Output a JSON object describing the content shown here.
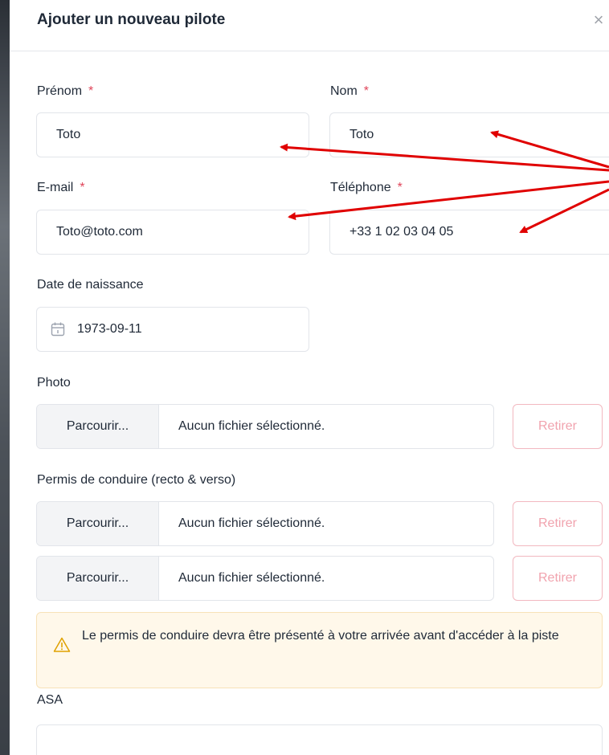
{
  "modal": {
    "title": "Ajouter un nouveau pilote",
    "close_icon": "×"
  },
  "form": {
    "required_mark": "*",
    "first_name": {
      "label": "Prénom",
      "value": "Toto"
    },
    "last_name": {
      "label": "Nom",
      "value": "Toto"
    },
    "email": {
      "label": "E-mail",
      "value": "Toto@toto.com"
    },
    "phone": {
      "label": "Téléphone",
      "value": "+33 1 02 03 04 05"
    },
    "birth_date": {
      "label": "Date de naissance",
      "value": "1973-09-11",
      "icon": "calendar-icon"
    },
    "photo": {
      "label": "Photo",
      "browse_label": "Parcourir...",
      "file_text": "Aucun fichier sélectionné.",
      "remove_label": "Retirer"
    },
    "license": {
      "label": "Permis de conduire (recto & verso)",
      "files": [
        {
          "browse_label": "Parcourir...",
          "file_text": "Aucun fichier sélectionné.",
          "remove_label": "Retirer"
        },
        {
          "browse_label": "Parcourir...",
          "file_text": "Aucun fichier sélectionné.",
          "remove_label": "Retirer"
        }
      ]
    },
    "license_notice": {
      "icon": "warning-icon",
      "text": "Le permis de conduire devra être présenté à votre arrivée avant d'accéder à la piste"
    },
    "asa": {
      "label": "ASA"
    }
  },
  "colors": {
    "required": "#e0455a",
    "remove_text": "#f1a3ae",
    "remove_border": "#f2b8c0",
    "notice_bg": "#fff8ea",
    "annotation_arrow": "#e00000"
  }
}
